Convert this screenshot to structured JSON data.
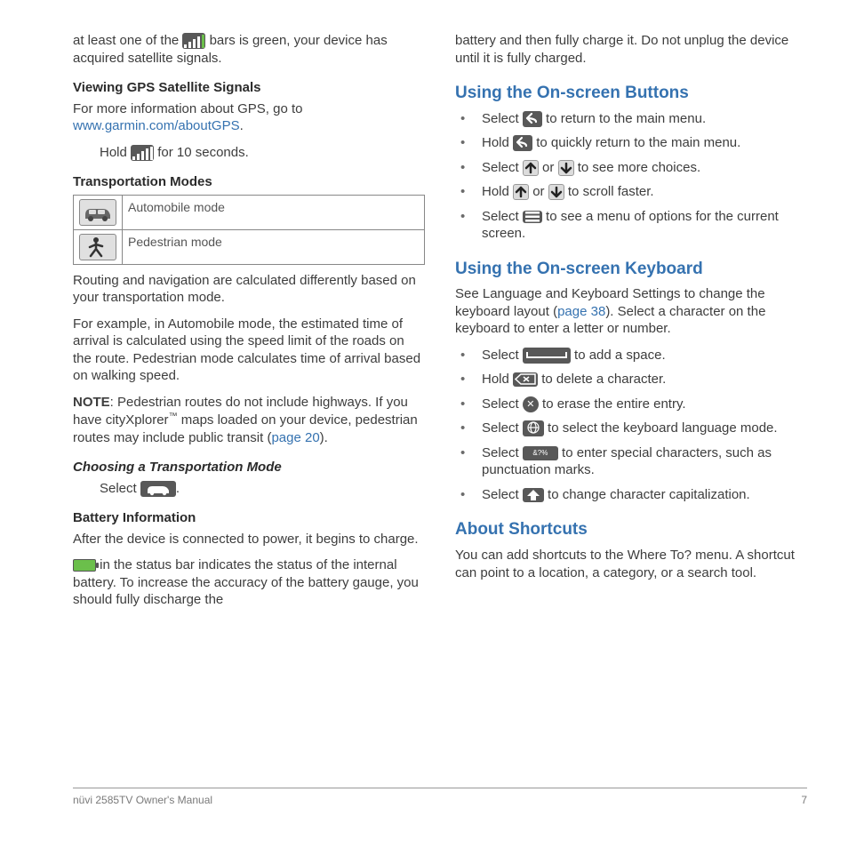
{
  "left": {
    "intro1a": "at least one of the ",
    "intro1b": " bars is green, your device has acquired satellite signals.",
    "h_gps": "Viewing GPS Satellite Signals",
    "gps_p1": "For more information about GPS, go to ",
    "gps_link": "www.garmin.com/aboutGPS",
    "gps_hold_a": "Hold ",
    "gps_hold_b": " for 10 seconds.",
    "h_trans": "Transportation Modes",
    "modes": {
      "auto": "Automobile mode",
      "ped": "Pedestrian mode"
    },
    "trans_p1": "Routing and navigation are calculated differently based on your transportation mode.",
    "trans_p2": "For example, in Automobile mode, the estimated time of arrival is calculated using the speed limit of the roads on the route. Pedestrian mode calculates time of arrival based on walking speed.",
    "note_label": "NOTE",
    "note_body_a": ": Pedestrian routes do not include highways. If you have cityXplorer",
    "note_tm": "™",
    "note_body_b": " maps loaded on your device, pedestrian routes may include public transit (",
    "note_link": "page 20",
    "note_body_c": ").",
    "h_choose": "Choosing a Transportation Mode",
    "choose_a": "Select ",
    "choose_b": ".",
    "h_batt": "Battery Information",
    "batt_p1": "After the device is connected to power, it begins to charge.",
    "batt_p2": " in the status bar indicates the status of the internal battery. To increase the accuracy of the battery gauge, you should fully discharge the"
  },
  "right": {
    "batt_cont": "battery and then fully charge it. Do not unplug the device until it is fully charged.",
    "h_buttons": "Using the On-screen Buttons",
    "btn1a": "Select ",
    "btn1b": " to return to the main menu.",
    "btn2a": "Hold ",
    "btn2b": " to quickly return to the main menu.",
    "btn3a": "Select ",
    "btn3_or": " or ",
    "btn3b": " to see more choices.",
    "btn4a": "Hold ",
    "btn4_or": " or ",
    "btn4b": " to scroll faster.",
    "btn5a": "Select ",
    "btn5b": " to see a menu of options for the current screen.",
    "h_kbd": "Using the On-screen Keyboard",
    "kbd_intro_a": "See Language and Keyboard Settings to change the keyboard layout (",
    "kbd_link": "page 38",
    "kbd_intro_b": "). Select a character on the keyboard to enter a letter or number.",
    "kbd1a": "Select ",
    "kbd1b": " to add a space.",
    "kbd2a": "Hold ",
    "kbd2b": " to delete a character.",
    "kbd3a": "Select ",
    "kbd3b": " to erase the entire entry.",
    "kbd4a": "Select ",
    "kbd4b": " to select the keyboard language mode.",
    "kbd5a": "Select ",
    "kbd5_lbl": "&?%",
    "kbd5b": " to enter special characters, such as punctuation marks.",
    "kbd6a": "Select ",
    "kbd6b": " to change character capitalization.",
    "h_short": "About Shortcuts",
    "short_p": "You can add shortcuts to the Where To? menu. A shortcut can point to a location, a category, or a search tool."
  },
  "footer": {
    "left": "nüvi 2585TV Owner's Manual",
    "right": "7"
  }
}
